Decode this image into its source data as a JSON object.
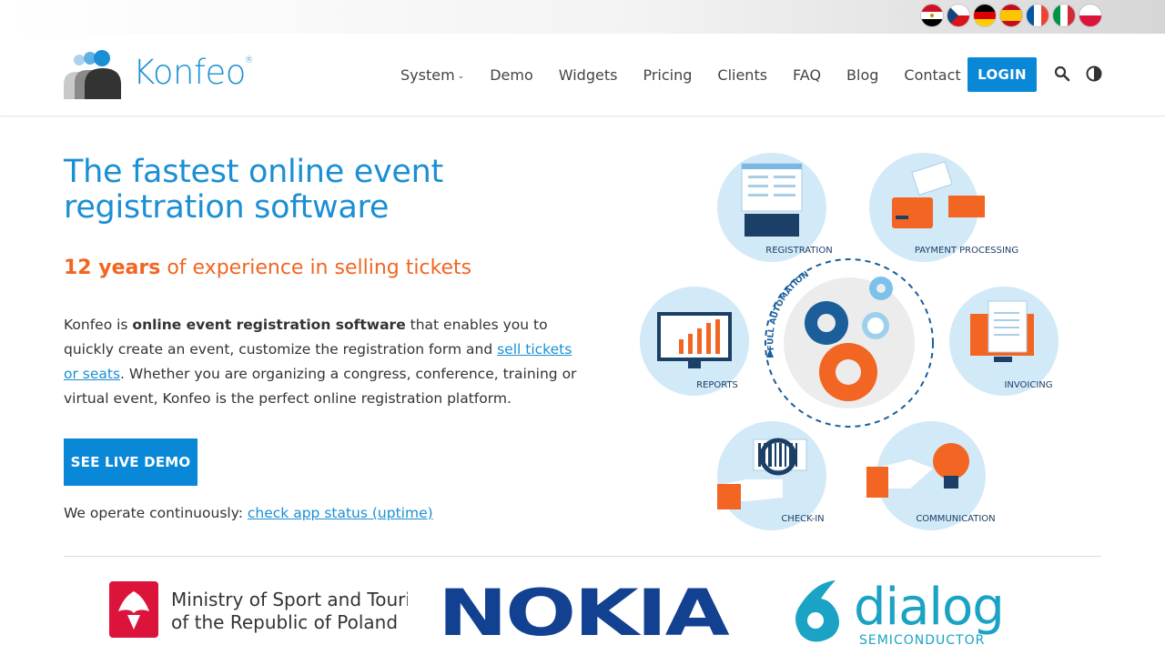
{
  "languages": [
    {
      "code": "ar",
      "name": "Egypt-flag-icon"
    },
    {
      "code": "cs",
      "name": "Czech-flag-icon"
    },
    {
      "code": "de",
      "name": "German-flag-icon"
    },
    {
      "code": "es",
      "name": "Spanish-flag-icon"
    },
    {
      "code": "fr",
      "name": "French-flag-icon"
    },
    {
      "code": "it",
      "name": "Italian-flag-icon"
    },
    {
      "code": "pl",
      "name": "Polish-flag-icon"
    }
  ],
  "brand": {
    "name": "Konfeo",
    "reg": "®",
    "color": "#1b8fd3"
  },
  "nav": {
    "system": "System",
    "demo": "Demo",
    "widgets": "Widgets",
    "pricing": "Pricing",
    "clients": "Clients",
    "faq": "FAQ",
    "blog": "Blog",
    "contact": "Contact",
    "login": "LOGIN"
  },
  "hero": {
    "title": "The fastest online event registration software",
    "sub_bold": "12 years",
    "sub_rest": " of experience in selling tickets",
    "desc_1": "Konfeo is ",
    "desc_bold": "online event registration software",
    "desc_2": " that enables you to quickly create an event, customize the registration form and ",
    "desc_link": "sell tickets or seats",
    "desc_3": ". Whether you are organizing a congress, conference, training or virtual event, Konfeo is the perfect online registration platform.",
    "cta": "SEE LIVE DEMO",
    "uptime_text": "We operate continuously: ",
    "uptime_link": "check app status (uptime)"
  },
  "diagram": {
    "center": "FULL AUTOMATION",
    "items": {
      "registration": "REGISTRATION",
      "payment": "PAYMENT PROCESSING",
      "reports": "REPORTS",
      "invoicing": "INVOICING",
      "checkin": "CHECK-IN",
      "communication": "COMMUNICATION"
    }
  },
  "clients": {
    "ministry_line1": "Ministry of Sport and Tourism",
    "ministry_line2": "of the Republic of Poland",
    "nokia": "NOKIA",
    "dialog": "dialog",
    "dialog_sub": "SEMICONDUCTOR"
  },
  "colors": {
    "accent": "#0a88d8",
    "orange": "#f26522",
    "light_blue_circle": "#d2e9f7",
    "nokia": "#124191",
    "dialog": "#1aa3c4"
  }
}
